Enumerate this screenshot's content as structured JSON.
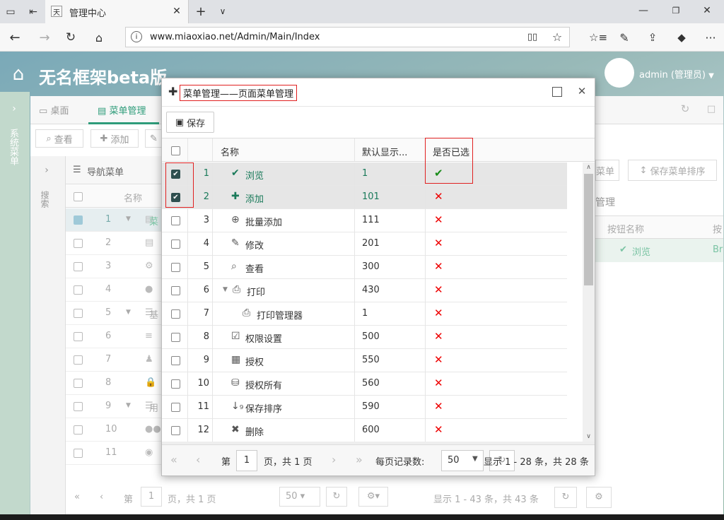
{
  "browser": {
    "tab_title": "管理中心",
    "url": "www.miaoxiao.net/Admin/Main/Index"
  },
  "app": {
    "title": "无名框架beta版",
    "user": "admin (管理员)",
    "side_label": "系统菜单",
    "search_label": "搜索"
  },
  "tabs": [
    {
      "label": "桌面"
    },
    {
      "label": "菜单管理"
    }
  ],
  "toolbar": {
    "view": "查看",
    "add": "添加"
  },
  "nav_panel": {
    "title": "导航菜单",
    "col_name": "名称"
  },
  "bg_rows": [
    "1",
    "2",
    "3",
    "4",
    "5",
    "6",
    "7",
    "8",
    "9",
    "10",
    "11"
  ],
  "bg_row_labels": {
    "r1": "菜",
    "r5": "基",
    "r9": "用"
  },
  "right_panel": {
    "btn_menu": "菜单",
    "btn_sort": "保存菜单排序",
    "section": "管理",
    "col_btn_name": "按钮名称",
    "col_extra": "按",
    "row_name": "浏览",
    "row_extra": "Br"
  },
  "bg_pager": {
    "page_label": "第",
    "page_value": "1",
    "of_pages": "页，共 1 页",
    "page_size": "50",
    "summary": "显示 1 - 43 条，共 43 条"
  },
  "dialog": {
    "title": "菜单管理——页面菜单管理",
    "save_button": "保存",
    "columns": {
      "name": "名称",
      "default": "默认显示...",
      "selected": "是否已选"
    },
    "rows": [
      {
        "num": "1",
        "icon": "check-icon",
        "name": "浏览",
        "value": "1",
        "selected": true,
        "checked": true
      },
      {
        "num": "2",
        "icon": "plus-icon",
        "name": "添加",
        "value": "101",
        "selected": false,
        "checked": true
      },
      {
        "num": "3",
        "icon": "plus-circle-icon",
        "name": "批量添加",
        "value": "111",
        "selected": false,
        "checked": false
      },
      {
        "num": "4",
        "icon": "pencil-icon",
        "name": "修改",
        "value": "201",
        "selected": false,
        "checked": false
      },
      {
        "num": "5",
        "icon": "search-icon",
        "name": "查看",
        "value": "300",
        "selected": false,
        "checked": false
      },
      {
        "num": "6",
        "icon": "print-icon",
        "name": "打印",
        "value": "430",
        "selected": false,
        "checked": false
      },
      {
        "num": "7",
        "icon": "print-icon",
        "name": "打印管理器",
        "value": "1",
        "selected": false,
        "checked": false
      },
      {
        "num": "8",
        "icon": "check-square-icon",
        "name": "权限设置",
        "value": "500",
        "selected": false,
        "checked": false
      },
      {
        "num": "9",
        "icon": "grid-icon",
        "name": "授权",
        "value": "550",
        "selected": false,
        "checked": false
      },
      {
        "num": "10",
        "icon": "hdd-icon",
        "name": "授权所有",
        "value": "560",
        "selected": false,
        "checked": false
      },
      {
        "num": "11",
        "icon": "sort-icon",
        "name": "保存排序",
        "value": "590",
        "selected": false,
        "checked": false
      },
      {
        "num": "12",
        "icon": "close-icon",
        "name": "删除",
        "value": "600",
        "selected": false,
        "checked": false
      }
    ],
    "pager": {
      "page_label": "第",
      "page_value": "1",
      "of_pages": "页，共 1 页",
      "page_size_label": "每页记录数:",
      "page_size": "50",
      "summary": "显示 1 - 28 条，共 28 条"
    }
  },
  "colors": {
    "accent": "#2e9c7a",
    "selected_text": "#1a7a5a",
    "red": "#e00000"
  }
}
